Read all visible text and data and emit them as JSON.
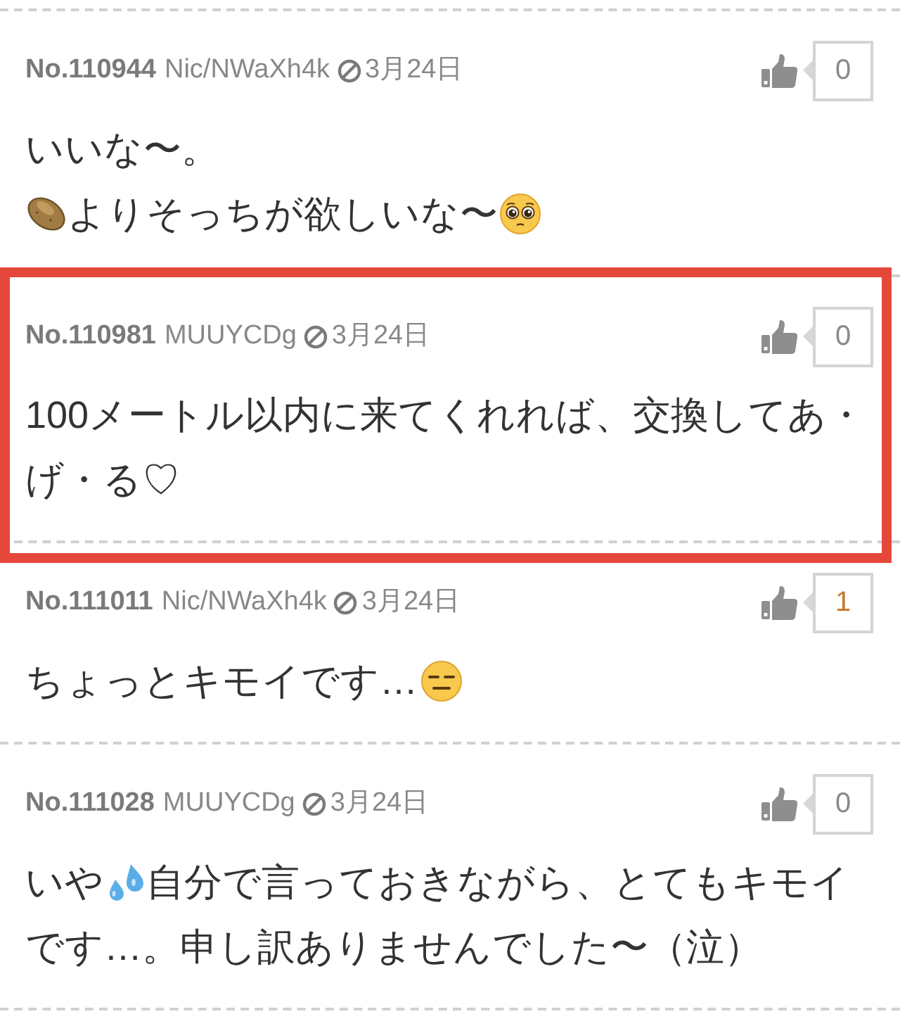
{
  "comments": [
    {
      "number": "No.110944",
      "author": "Nic/NWaXh4k",
      "date": "3月24日",
      "like_count": {
        "value": "0",
        "active": false
      },
      "highlighted": false,
      "lines": [
        [
          {
            "kind": "text",
            "text": "いいな〜。"
          }
        ],
        [
          {
            "kind": "potato"
          },
          {
            "kind": "text",
            "text": "よりそっちが欲しいな〜"
          },
          {
            "kind": "pleading"
          }
        ]
      ]
    },
    {
      "number": "No.110981",
      "author": "MUUYCDg",
      "date": "3月24日",
      "like_count": {
        "value": "0",
        "active": false
      },
      "highlighted": true,
      "lines": [
        [
          {
            "kind": "text",
            "text": "100メートル以内に来てくれれば、交換してあ・"
          }
        ],
        [
          {
            "kind": "text",
            "text": "げ・る♡"
          }
        ]
      ]
    },
    {
      "number": "No.111011",
      "author": "Nic/NWaXh4k",
      "date": "3月24日",
      "like_count": {
        "value": "1",
        "active": true
      },
      "highlighted": false,
      "lines": [
        [
          {
            "kind": "text",
            "text": "ちょっとキモイです…"
          },
          {
            "kind": "expressionless"
          }
        ]
      ]
    },
    {
      "number": "No.111028",
      "author": "MUUYCDg",
      "date": "3月24日",
      "like_count": {
        "value": "0",
        "active": false
      },
      "highlighted": false,
      "lines": [
        [
          {
            "kind": "text",
            "text": "いや"
          },
          {
            "kind": "droplets"
          },
          {
            "kind": "text",
            "text": "自分で言っておきながら、とてもキモイ"
          }
        ],
        [
          {
            "kind": "text",
            "text": "です…。申し訳ありませんでした〜（泣）"
          }
        ]
      ]
    }
  ]
}
